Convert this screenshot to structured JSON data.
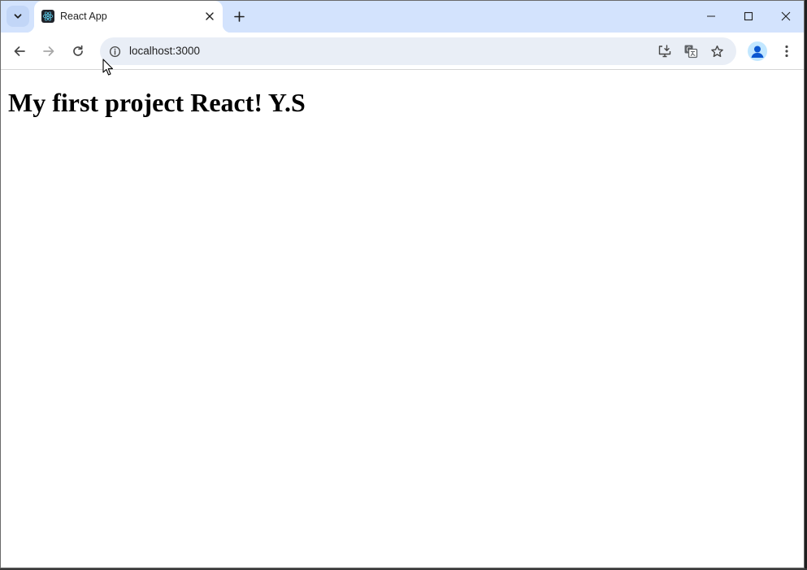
{
  "browser": {
    "tab": {
      "title": "React App",
      "favicon": "react-logo-icon"
    },
    "address_bar": {
      "url": "localhost:3000"
    },
    "icons": {
      "tab_search": "chevron-down-icon",
      "tab_close": "close-icon",
      "new_tab": "plus-icon",
      "minimize": "minimize-icon",
      "maximize": "maximize-icon",
      "close_window": "close-icon",
      "back": "arrow-left-icon",
      "forward": "arrow-right-icon",
      "reload": "reload-icon",
      "site_info": "info-icon",
      "install_app": "install-app-icon",
      "translate": "translate-icon",
      "bookmark": "star-icon",
      "profile": "avatar-icon",
      "menu": "more-vert-icon"
    },
    "colors": {
      "tabstrip": "#d3e3fd",
      "omnibox": "#e9eef6",
      "react_blue": "#61dafb",
      "profile_blue": "#0b57d0"
    }
  },
  "page": {
    "heading": "My first project React! Y.S"
  }
}
